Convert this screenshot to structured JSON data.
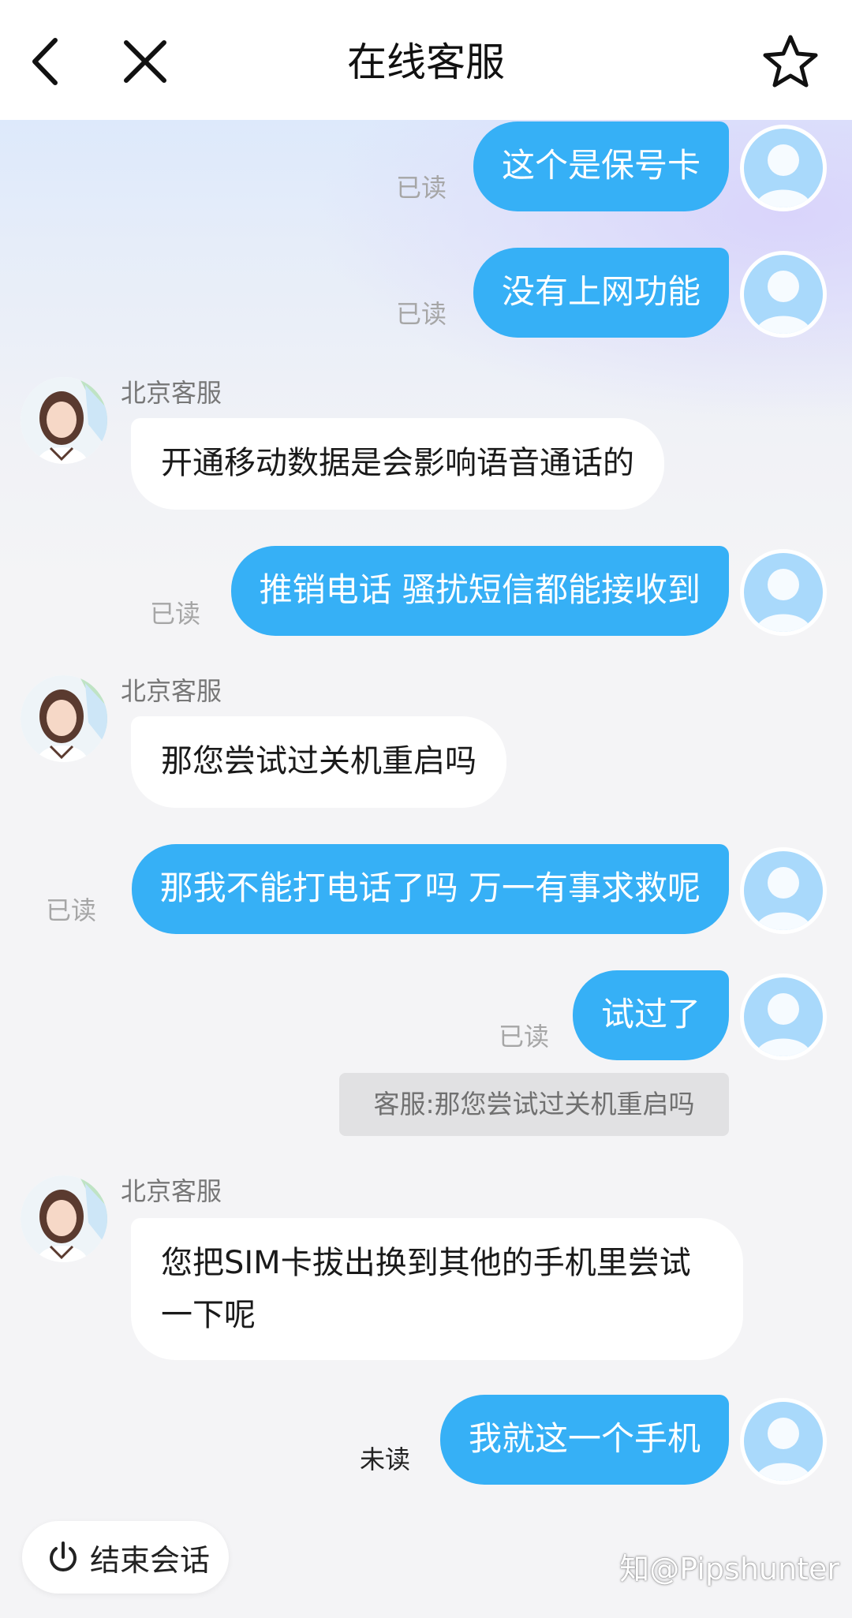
{
  "header": {
    "title": "在线客服",
    "back_icon": "chevron-left-icon",
    "close_icon": "close-icon",
    "favorite_icon": "star-outline-icon"
  },
  "messages": [
    {
      "from": "user",
      "text": "这个是保号卡",
      "status": "已读"
    },
    {
      "from": "user",
      "text": "没有上网功能",
      "status": "已读"
    },
    {
      "from": "agent",
      "sender": "北京客服",
      "text": "开通移动数据是会影响语音通话的"
    },
    {
      "from": "user",
      "text": "推销电话 骚扰短信都能接收到",
      "status": "已读"
    },
    {
      "from": "agent",
      "sender": "北京客服",
      "text": "那您尝试过关机重启吗"
    },
    {
      "from": "user",
      "text": "那我不能打电话了吗 万一有事求救呢",
      "status": "已读"
    },
    {
      "from": "user",
      "text": "试过了",
      "status": "已读",
      "quote": "客服:那您尝试过关机重启吗"
    },
    {
      "from": "agent",
      "sender": "北京客服",
      "text": "您把SIM卡拔出换到其他的手机里尝试一下呢"
    },
    {
      "from": "user",
      "text": "我就这一个手机",
      "status": "未读"
    }
  ],
  "footer": {
    "end_session_label": "结束会话",
    "end_session_icon": "power-icon"
  },
  "watermark": "知@Pipshunter",
  "colors": {
    "user_bubble": "#36b0f6",
    "agent_bubble": "#ffffff",
    "background": "#f4f4f6",
    "read_text": "#a6a6a6"
  }
}
